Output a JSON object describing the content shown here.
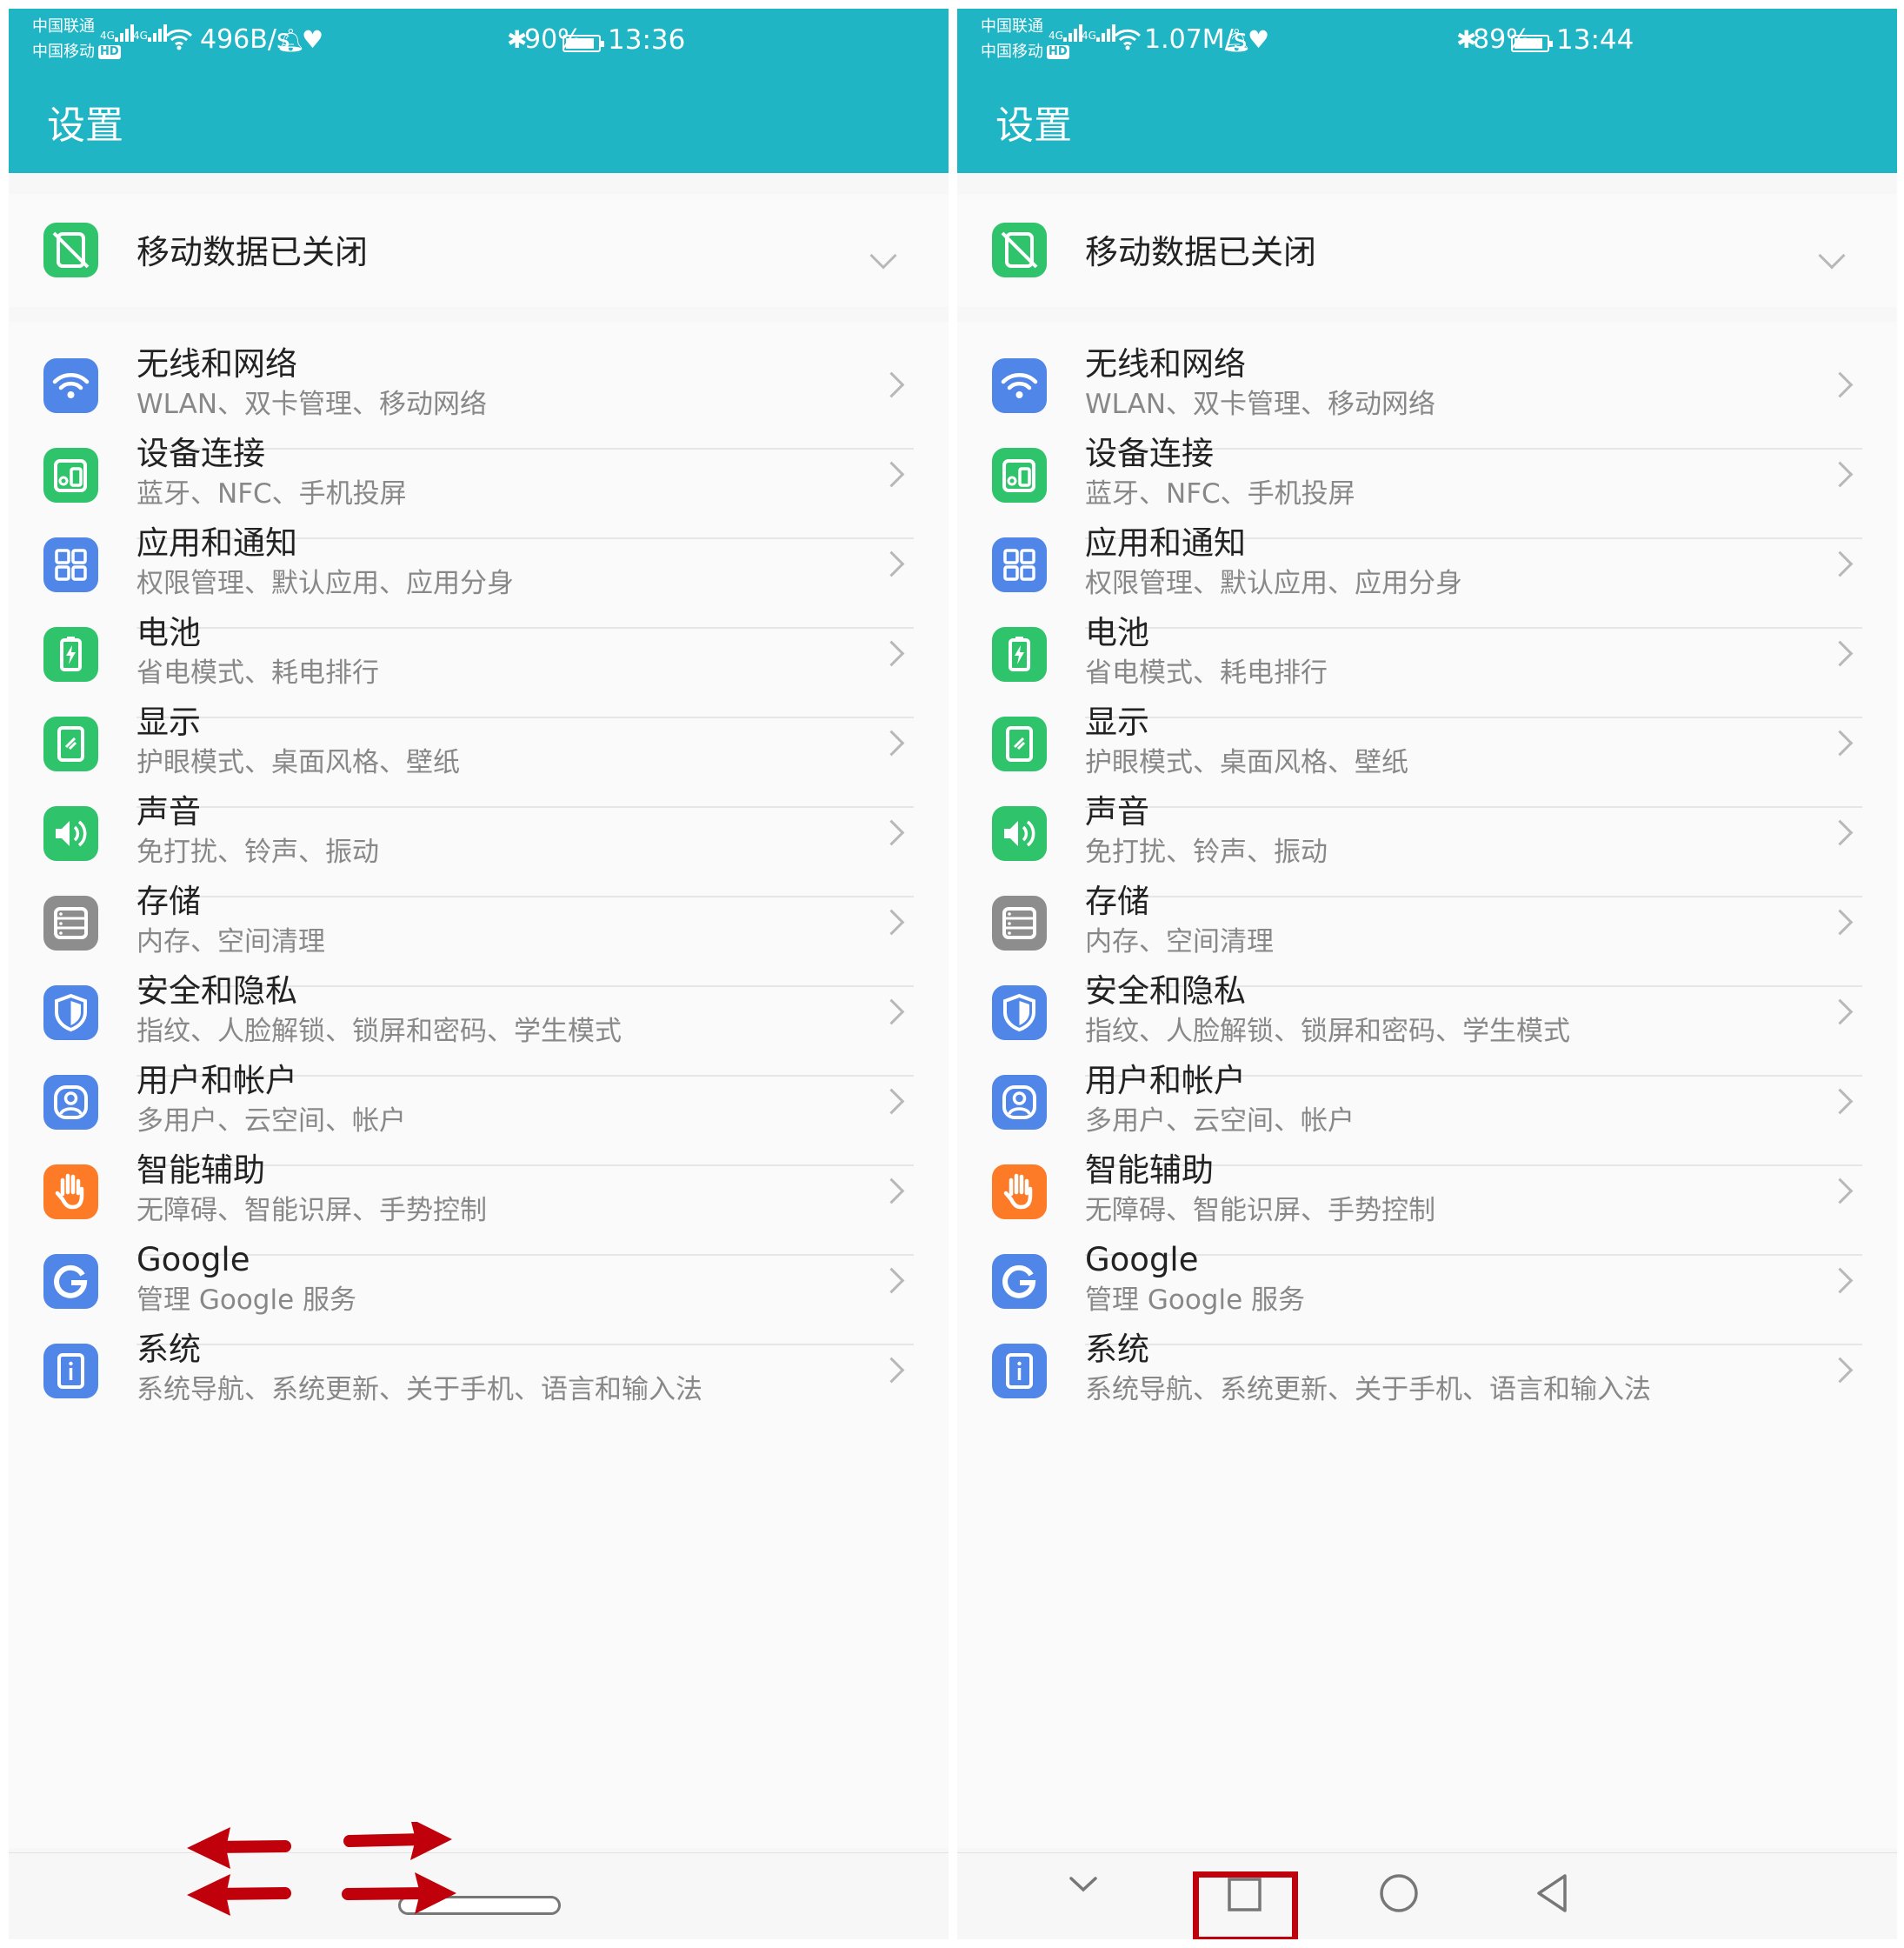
{
  "colors": {
    "header": "#1fb5c5",
    "background": "#f7f7f7",
    "card": "#fafafa",
    "title_text": "#222222",
    "subtitle_text": "#888888",
    "blue_icon": "#4f86e8",
    "green_icon": "#2fc36b",
    "gray_icon": "#8d8d8d",
    "orange_icon": "#fd7b27",
    "arrow_red": "#c0000a"
  },
  "phones": [
    {
      "status_bar": {
        "carrier_1": "中国联通",
        "carrier_2": "中国移动",
        "hd": "HD",
        "net_type": "4G",
        "net_speed": "496B/s",
        "bluetooth": "✱",
        "battery": "90%",
        "battery_level": 0.9,
        "time": "13:36"
      },
      "title": "设置",
      "mobile_data_label": "移动数据已关闭",
      "settings": [
        {
          "title": "无线和网络",
          "subtitle": "WLAN、双卡管理、移动网络",
          "icon": "wifi-icon",
          "color": "blue"
        },
        {
          "title": "设备连接",
          "subtitle": "蓝牙、NFC、手机投屏",
          "icon": "device-connect-icon",
          "color": "green"
        },
        {
          "title": "应用和通知",
          "subtitle": "权限管理、默认应用、应用分身",
          "icon": "apps-grid-icon",
          "color": "blue"
        },
        {
          "title": "电池",
          "subtitle": "省电模式、耗电排行",
          "icon": "battery-icon",
          "color": "green"
        },
        {
          "title": "显示",
          "subtitle": "护眼模式、桌面风格、壁纸",
          "icon": "display-icon",
          "color": "green"
        },
        {
          "title": "声音",
          "subtitle": "免打扰、铃声、振动",
          "icon": "speaker-icon",
          "color": "green"
        },
        {
          "title": "存储",
          "subtitle": "内存、空间清理",
          "icon": "storage-icon",
          "color": "gray"
        },
        {
          "title": "安全和隐私",
          "subtitle": "指纹、人脸解锁、锁屏和密码、学生模式",
          "icon": "shield-icon",
          "color": "blue"
        },
        {
          "title": "用户和帐户",
          "subtitle": "多用户、云空间、帐户",
          "icon": "user-icon",
          "color": "blue"
        },
        {
          "title": "智能辅助",
          "subtitle": "无障碍、智能识屏、手势控制",
          "icon": "hand-icon",
          "color": "orange"
        },
        {
          "title": "Google",
          "subtitle": "管理 Google 服务",
          "icon": "google-icon",
          "color": "blue"
        },
        {
          "title": "系统",
          "subtitle": "系统导航、系统更新、关于手机、语言和输入法",
          "icon": "system-info-icon",
          "color": "blue"
        }
      ],
      "navigation": "gesture-pill"
    },
    {
      "status_bar": {
        "carrier_1": "中国联通",
        "carrier_2": "中国移动",
        "hd": "HD",
        "net_type": "4G",
        "net_speed": "1.07M/s",
        "bluetooth": "✱",
        "battery": "89%",
        "battery_level": 0.89,
        "time": "13:44"
      },
      "title": "设置",
      "mobile_data_label": "移动数据已关闭",
      "settings": [
        {
          "title": "无线和网络",
          "subtitle": "WLAN、双卡管理、移动网络",
          "icon": "wifi-icon",
          "color": "blue"
        },
        {
          "title": "设备连接",
          "subtitle": "蓝牙、NFC、手机投屏",
          "icon": "device-connect-icon",
          "color": "green"
        },
        {
          "title": "应用和通知",
          "subtitle": "权限管理、默认应用、应用分身",
          "icon": "apps-grid-icon",
          "color": "blue"
        },
        {
          "title": "电池",
          "subtitle": "省电模式、耗电排行",
          "icon": "battery-icon",
          "color": "green"
        },
        {
          "title": "显示",
          "subtitle": "护眼模式、桌面风格、壁纸",
          "icon": "display-icon",
          "color": "green"
        },
        {
          "title": "声音",
          "subtitle": "免打扰、铃声、振动",
          "icon": "speaker-icon",
          "color": "green"
        },
        {
          "title": "存储",
          "subtitle": "内存、空间清理",
          "icon": "storage-icon",
          "color": "gray"
        },
        {
          "title": "安全和隐私",
          "subtitle": "指纹、人脸解锁、锁屏和密码、学生模式",
          "icon": "shield-icon",
          "color": "blue"
        },
        {
          "title": "用户和帐户",
          "subtitle": "多用户、云空间、帐户",
          "icon": "user-icon",
          "color": "blue"
        },
        {
          "title": "智能辅助",
          "subtitle": "无障碍、智能识屏、手势控制",
          "icon": "hand-icon",
          "color": "orange"
        },
        {
          "title": "Google",
          "subtitle": "管理 Google 服务",
          "icon": "google-icon",
          "color": "blue"
        },
        {
          "title": "系统",
          "subtitle": "系统导航、系统更新、关于手机、语言和输入法",
          "icon": "system-info-icon",
          "color": "blue"
        }
      ],
      "navigation": "three-key",
      "nav_keys": [
        "collapse-down-icon",
        "recents-square-icon",
        "home-circle-icon",
        "back-triangle-icon"
      ],
      "highlighted_key": "recents-square-icon"
    }
  ]
}
